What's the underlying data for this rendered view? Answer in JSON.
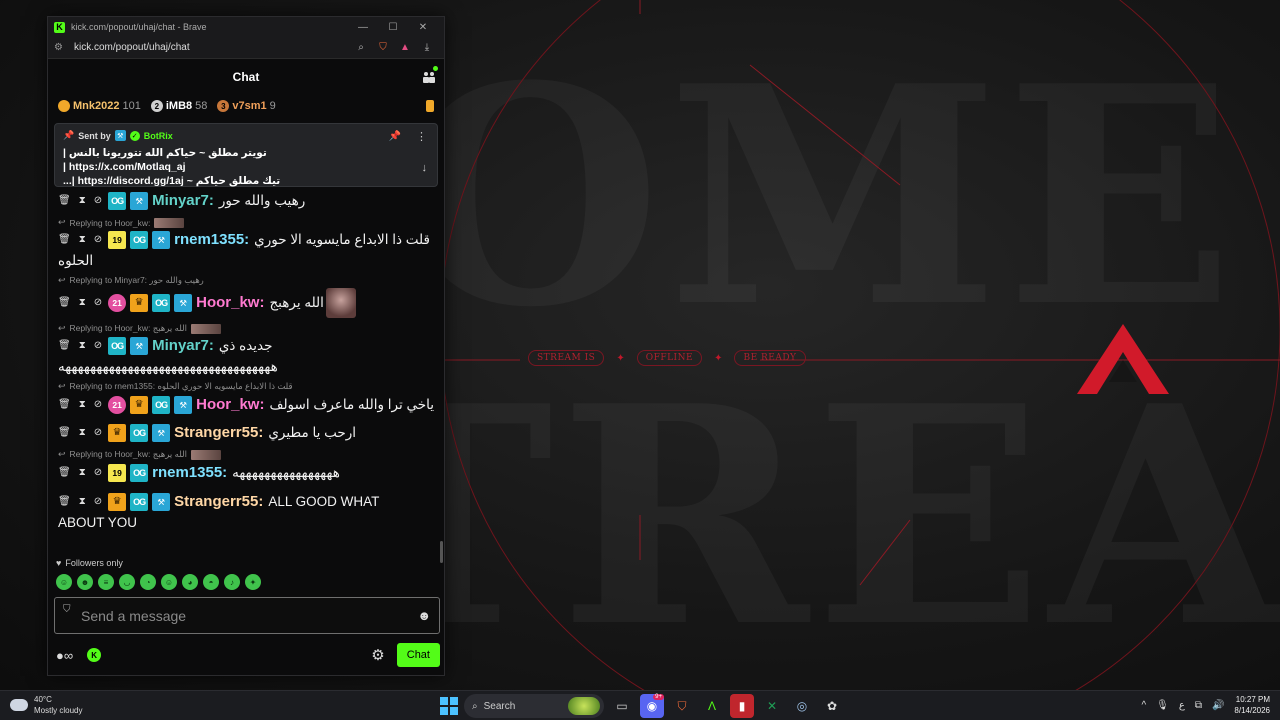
{
  "window": {
    "title": "kick.com/popout/uhaj/chat - Brave",
    "url": "kick.com/popout/uhaj/chat"
  },
  "chat": {
    "title": "Chat",
    "leaderboard": [
      {
        "name": "Mnk2022",
        "count": "101",
        "color": "#f5c16c",
        "badge_color": "#f0a82a",
        "badge": ""
      },
      {
        "name": "iMB8",
        "count": "58",
        "color": "#ffffff",
        "badge_color": "#cfcfcf",
        "badge": "2"
      },
      {
        "name": "v7sm1",
        "count": "9",
        "color": "#f0a05a",
        "badge_color": "#c8773a",
        "badge": "3"
      }
    ],
    "pinned": {
      "sent_by": "Sent by",
      "bot_name": "BotRix",
      "line1": "تويتر مطلق ~ حياكم الله تتوريونا بالنس | https://x.com/Motlaq_aj |",
      "line2": "تيك مطلق حياكم ~ https://discord.gg/1aj |...",
      "link1": "https://x.com/Motlaq_aj",
      "link2": "https://discord.gg/1aj"
    },
    "messages": [
      {
        "reply": null,
        "badges": [
          "og",
          "mod"
        ],
        "user": "Minyar7:",
        "color": "c-green",
        "text": "رهيب والله حور",
        "extra": null
      },
      {
        "reply": "Replying to Hoor_kw:",
        "badges": [
          "19",
          "og",
          "mod"
        ],
        "user": "rnem1355:",
        "color": "c-cyan",
        "text": "قلت ذا الابداع مايسويه الا حوري",
        "extra": "الحلوه"
      },
      {
        "reply": "Replying to Minyar7: رهيب والله حور",
        "badges": [
          "21",
          "crown",
          "og",
          "mod"
        ],
        "user": "Hoor_kw:",
        "color": "c-pink",
        "text": "الله يرهبج",
        "extra": null
      },
      {
        "reply": "Replying to Hoor_kw: الله يرهبج",
        "badges": [
          "og",
          "mod"
        ],
        "user": "Minyar7:",
        "color": "c-green",
        "text": "جديده ذي",
        "extra": "ههههههههههههههههههههههههههههههههههه"
      },
      {
        "reply": "Replying to rnem1355: قلت ذا الابداع مايسويه الا حوري الحلوه",
        "badges": [
          "21",
          "crown",
          "og",
          "mod"
        ],
        "user": "Hoor_kw:",
        "color": "c-pink",
        "text": "ياخي ترا والله ماعرف اسولف",
        "extra": null
      },
      {
        "reply": null,
        "badges": [
          "crown",
          "og",
          "mod"
        ],
        "user": "Strangerr55:",
        "color": "c-peach",
        "text": "ارحب يا مطيري",
        "extra": null
      },
      {
        "reply": "Replying to Hoor_kw: الله يرهبج",
        "badges": [
          "19",
          "og"
        ],
        "user": "rnem1355:",
        "color": "c-cyan",
        "text": "ههههههههههههههههه",
        "extra": null
      },
      {
        "reply": null,
        "badges": [
          "crown",
          "og",
          "mod"
        ],
        "user": "Strangerr55:",
        "color": "c-peach",
        "text": "ALL GOOD WHAT",
        "extra": "ABOUT YOU"
      }
    ],
    "followers_only": "Followers only",
    "input_placeholder": "Send a message",
    "send_label": "Chat"
  },
  "background": {
    "tags": [
      "STREAM IS",
      "OFFLINE",
      "BE READY"
    ]
  },
  "taskbar": {
    "temp": "40°C",
    "weather": "Mostly cloudy",
    "search": "Search",
    "time": "10:27 PM",
    "date": "8/14/2026",
    "lang": "ع"
  },
  "colors": {
    "kick_green": "#53fc18",
    "accent_red": "#d11a2a"
  }
}
